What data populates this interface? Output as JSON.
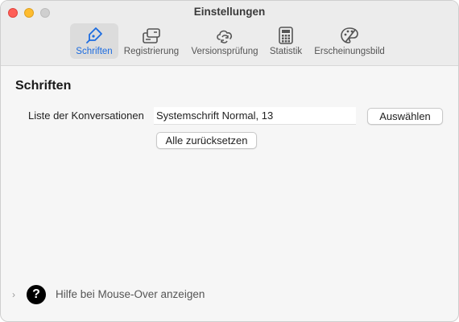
{
  "window": {
    "title": "Einstellungen"
  },
  "toolbar": {
    "items": [
      {
        "label": "Schriften",
        "icon": "pen-nib-icon",
        "selected": true
      },
      {
        "label": "Registrierung",
        "icon": "license-card-icon",
        "selected": false
      },
      {
        "label": "Versionsprüfung",
        "icon": "cloud-sync-icon",
        "selected": false
      },
      {
        "label": "Statistik",
        "icon": "calculator-icon",
        "selected": false
      },
      {
        "label": "Erscheinungsbild",
        "icon": "palette-icon",
        "selected": false
      }
    ]
  },
  "fonts": {
    "section_title": "Schriften",
    "conversation_list_label": "Liste der Konversationen",
    "conversation_list_font": "Systemschrift Normal, 13",
    "choose_button": "Auswählen",
    "reset_button": "Alle zurücksetzen"
  },
  "help": {
    "chevron": "›",
    "icon_glyph": "?",
    "label": "Hilfe bei Mouse-Over anzeigen"
  },
  "colors": {
    "accent": "#1c6ce0",
    "close": "#fe5f57",
    "minimize": "#febc2e"
  }
}
